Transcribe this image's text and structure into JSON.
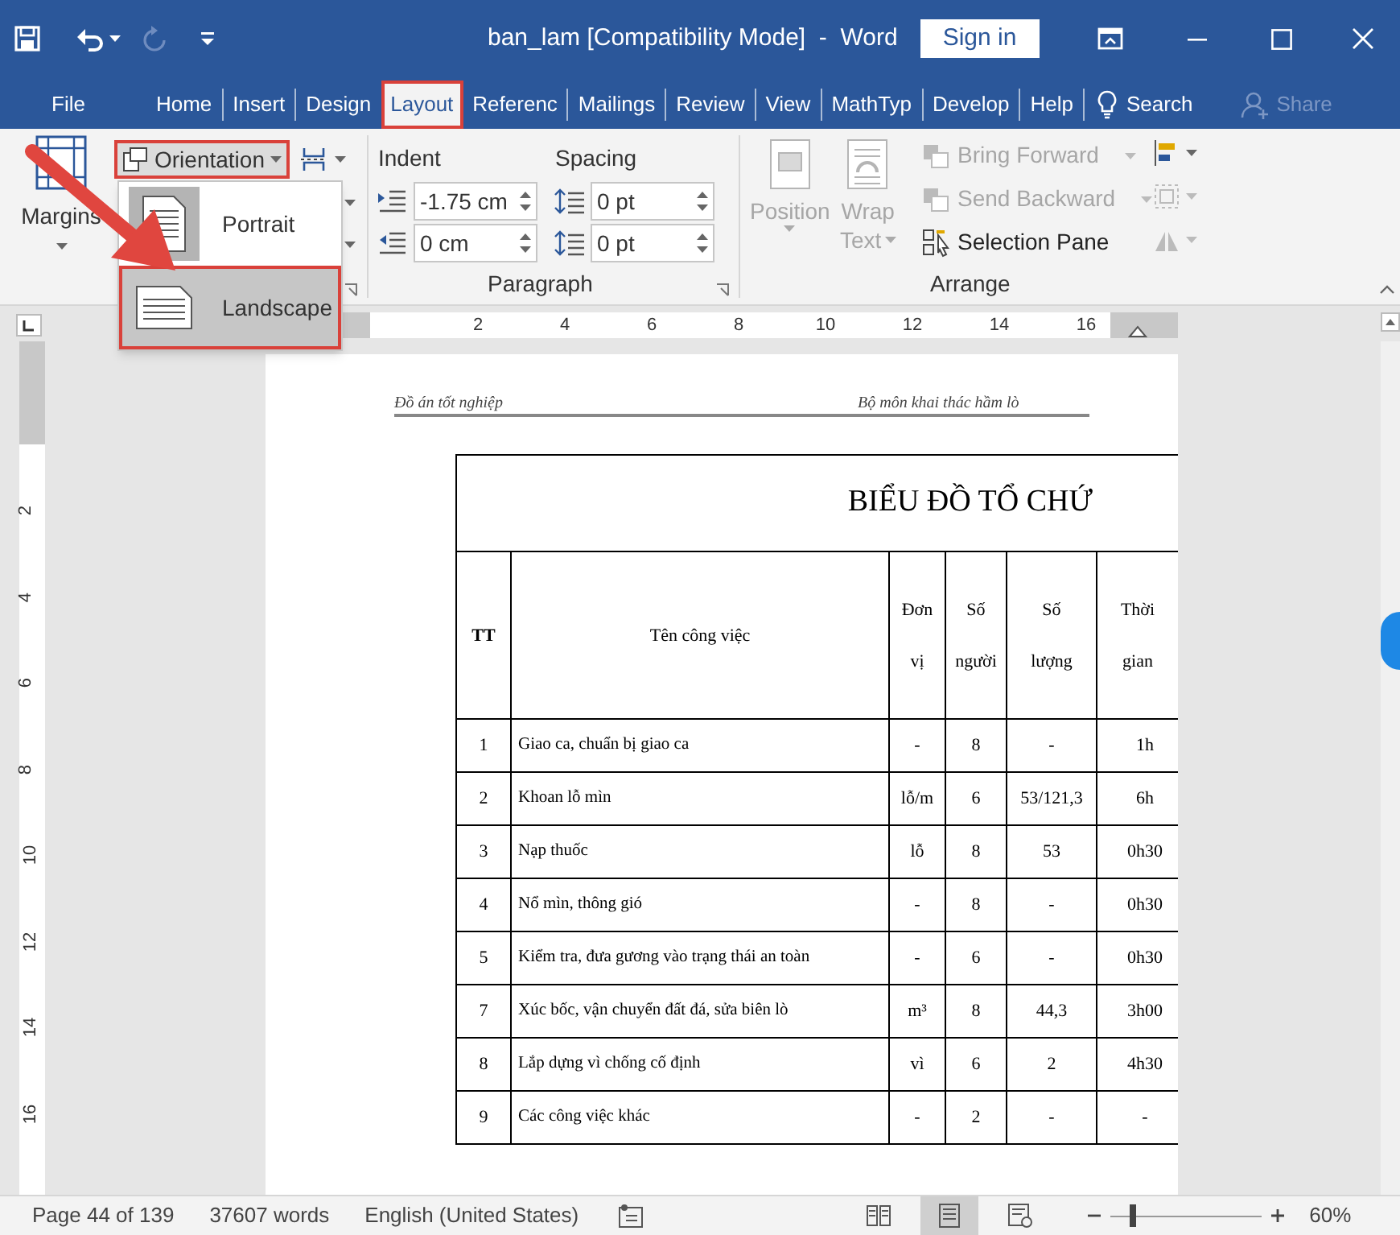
{
  "window": {
    "title": "ban_lam [Compatibility Mode]  -  Word",
    "sign_in": "Sign in"
  },
  "tabs": [
    {
      "label": "File",
      "selected": false,
      "highlighted": false
    },
    {
      "label": "Home",
      "selected": false,
      "highlighted": false
    },
    {
      "label": "Insert",
      "selected": false,
      "highlighted": false
    },
    {
      "label": "Design",
      "selected": false,
      "highlighted": false
    },
    {
      "label": "Layout",
      "selected": true,
      "highlighted": true
    },
    {
      "label": "Referenc",
      "selected": false,
      "highlighted": false
    },
    {
      "label": "Mailings",
      "selected": false,
      "highlighted": false
    },
    {
      "label": "Review",
      "selected": false,
      "highlighted": false
    },
    {
      "label": "View",
      "selected": false,
      "highlighted": false
    },
    {
      "label": "MathTyp",
      "selected": false,
      "highlighted": false
    },
    {
      "label": "Develop",
      "selected": false,
      "highlighted": false
    },
    {
      "label": "Help",
      "selected": false,
      "highlighted": false
    }
  ],
  "search": "Search",
  "share": {
    "label": "Share",
    "disabled": true
  },
  "ribbon": {
    "margins": "Margins",
    "orientation": {
      "label": "Orientation",
      "highlighted": true
    },
    "orientation_menu": [
      {
        "label": "Portrait",
        "kind": "portrait",
        "checked": true,
        "selected": false
      },
      {
        "label": "Landscape",
        "kind": "landscape",
        "checked": false,
        "selected": true
      }
    ],
    "indent": {
      "label": "Indent",
      "left": "-1.75 cm",
      "right": "0 cm"
    },
    "spacing": {
      "label": "Spacing",
      "before": "0 pt",
      "after": "0 pt"
    },
    "paragraph_group": "Paragraph",
    "arrange_large": [
      {
        "label": "Position",
        "disabled": true
      },
      {
        "label": "Wrap",
        "sublabel": "Text",
        "disabled": true
      }
    ],
    "arrange_small": [
      {
        "label": "Bring Forward",
        "kind": "bring",
        "disabled": true
      },
      {
        "label": "Send Backward",
        "kind": "send",
        "disabled": true
      },
      {
        "label": "Selection Pane",
        "kind": "pane",
        "disabled": false
      }
    ],
    "arrange_group": "Arrange"
  },
  "horizontal_ruler": [
    "2",
    "4",
    "6",
    "8",
    "10",
    "12",
    "14",
    "16"
  ],
  "vertical_ruler": [
    "2",
    "4",
    "6",
    "8",
    "10",
    "12",
    "14",
    "16"
  ],
  "document": {
    "header_left": "Đồ án tốt nghiệp",
    "header_right": "Bộ môn khai thác hầm lò",
    "table_title": "BIỂU ĐỒ TỔ CHỨ",
    "columns": [
      "TT",
      "Tên công việc",
      "Đơn vị",
      "Số người",
      "Số lượng",
      "Thời gian"
    ],
    "rows": [
      [
        "1",
        "Giao ca, chuẩn bị giao ca",
        "-",
        "8",
        "-",
        "1h"
      ],
      [
        "2",
        "Khoan lỗ mìn",
        "lỗ/m",
        "6",
        "53/121,3",
        "6h"
      ],
      [
        "3",
        "Nạp thuốc",
        "lỗ",
        "8",
        "53",
        "0h30"
      ],
      [
        "4",
        "Nổ mìn, thông gió",
        "-",
        "8",
        "-",
        "0h30"
      ],
      [
        "5",
        "Kiểm tra, đưa gương vào trạng thái an toàn",
        "-",
        "6",
        "-",
        "0h30"
      ],
      [
        "7",
        "Xúc bốc, vận chuyển đất đá, sửa biên lò",
        "m³",
        "8",
        "44,3",
        "3h00"
      ],
      [
        "8",
        "Lắp dựng vì chống cố định",
        "vì",
        "6",
        "2",
        "4h30"
      ],
      [
        "9",
        "Các công việc khác",
        "-",
        "2",
        "-",
        "-"
      ]
    ]
  },
  "status_bar": {
    "page": "Page 44 of 139",
    "words": "37607 words",
    "language": "English (United States)",
    "views": [
      {
        "kind": "read",
        "selected": false
      },
      {
        "kind": "print",
        "selected": true
      },
      {
        "kind": "web",
        "selected": false
      }
    ],
    "zoom": {
      "level": 0.15,
      "reading": "60%"
    }
  }
}
